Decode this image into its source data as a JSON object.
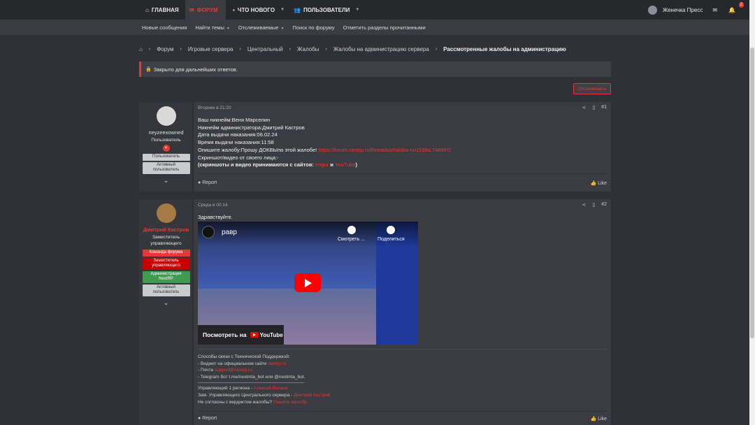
{
  "nav": {
    "tabs": [
      {
        "label": "ГЛАВНАЯ",
        "icon": "home-icon"
      },
      {
        "label": "ФОРУМ",
        "icon": "forum-icon"
      },
      {
        "label": "ЧТО НОВОГО",
        "icon": "chat-icon"
      },
      {
        "label": "ПОЛЬЗОВАТЕЛИ",
        "icon": "users-icon"
      }
    ],
    "user_name": "Женечка Пресс",
    "alerts_count": "2"
  },
  "subnav": [
    "Новые сообщения",
    "Найти темы",
    "Отслеживаемые",
    "Поиск по форуму",
    "Отметить разделы прочитанными"
  ],
  "breadcrumb": [
    "Форум",
    "Игровые сервера",
    "Центральный",
    "Жалобы",
    "Жалобы на администрацию сервера",
    "Рассмотренные жалобы на администрацию"
  ],
  "notice": "Закрыто для дальнейших ответов.",
  "watch_button": "Отслеживать",
  "post1": {
    "username": "neyzeexowned",
    "title": "Пользователь",
    "badges": [
      "Пользователь",
      "Активный пользователь"
    ],
    "time": "Вторник в 21:20",
    "number": "#1",
    "lines": [
      "Ваш никнейм:Веня Марселин",
      "Никнейм администратора:Дмитрий Кастров",
      "Дата выдачи наказания:06.02.24",
      "Время выдачи наказания:11:58"
    ],
    "complaint_prefix": "Опишите жалобу:Прошу ДОКВЫпо этой жалобе!",
    "complaint_link": "https://forum.nextrp.ru/threads/zhaloba-no1539a.748967/",
    "screenshot_line": "Скриншот/видео от своего лица:-",
    "sites_prefix": "(скриншоты и видео принимаются с сайтов:",
    "site1": "Imgur",
    "and": "и",
    "site2": "YouTube",
    "sites_suffix": ")",
    "report": "Report",
    "like": "Like"
  },
  "post2": {
    "username": "Дмитрий Кастров",
    "title": "Заместитель управляющего",
    "badges": [
      "Команда форума",
      "Заместитель управляющего",
      "Администрация NextRP",
      "Активный пользователь"
    ],
    "time": "Среда в 00:14",
    "number": "#2",
    "greeting": "Здравствуйте.",
    "video": {
      "title": "равр",
      "watch_later": "Смотреть ...",
      "share": "Поделиться",
      "watch_on": "Посмотреть на",
      "yt": "YouTube"
    },
    "sig": {
      "l1": "Способы связи с Технической Поддержкой:",
      "l2_prefix": "- Виджет на официальном сайте",
      "l2_link": "nextrp.ru",
      "l3_prefix": "- Почта",
      "l3_link": "support@nextrp.ru",
      "l4": "- Telegram бот t.me/nextmta_bot или @nextmta_bot.",
      "l5_prefix": "Управляющий 1 региона -",
      "l5_link": "Алексей Висаев",
      "l6_prefix": "Зам. Управляющего Центрального сервера -",
      "l6_link": "Дмитрий Кастров",
      "l7_prefix": "Не согласны с вердиктом жалобы?",
      "l7_link": "Пишите жалобу."
    },
    "report": "Report",
    "like": "Like"
  },
  "colors": {
    "accent": "#e53935",
    "bg": "#2f3136",
    "panel": "#3a3c41"
  }
}
